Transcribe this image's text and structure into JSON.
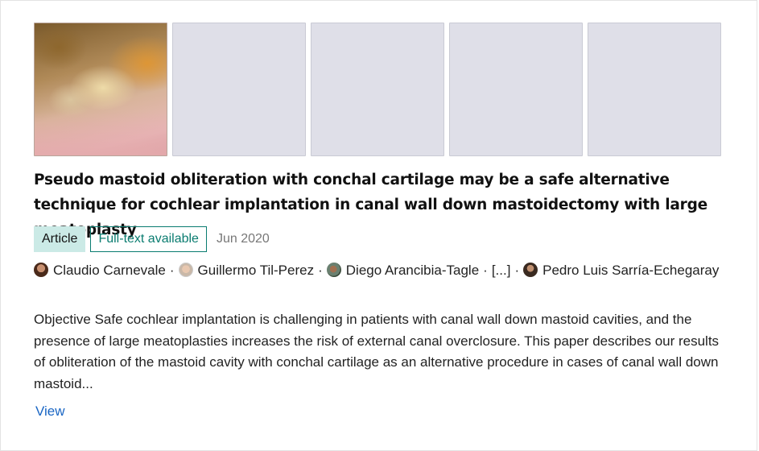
{
  "publication": {
    "figures": [
      {
        "type": "photo",
        "alt": "surgical image"
      },
      {
        "type": "placeholder"
      },
      {
        "type": "placeholder"
      },
      {
        "type": "placeholder"
      },
      {
        "type": "placeholder"
      }
    ],
    "title": "Pseudo mastoid obliteration with conchal cartilage may be a safe alternative technique for cochlear implantation in canal wall down mastoidectomy with large meatoplasty",
    "type_badge": "Article",
    "availability_badge": "Full-text available",
    "date": "Jun 2020",
    "authors": [
      {
        "name": "Claudio Carnevale"
      },
      {
        "name": "Guillermo Til-Perez"
      },
      {
        "name": "Diego Arancibia-Tagle"
      },
      {
        "name": "[...]"
      },
      {
        "name": "Pedro Luis Sarría-Echegaray"
      }
    ],
    "separator": "·",
    "abstract": "Objective Safe cochlear implantation is challenging in patients with canal wall down mastoid cavities, and the presence of large meatoplasties increases the risk of external canal overclosure. This paper describes our results of obliteration of the mastoid cavity with conchal cartilage as an alternative procedure in cases of canal wall down mastoid...",
    "view_label": "View"
  },
  "colors": {
    "article_badge_bg": "#cbeae6",
    "fulltext_badge": "#0a7c70",
    "link": "#1a66c4",
    "placeholder_bg": "#dfdfe8"
  }
}
